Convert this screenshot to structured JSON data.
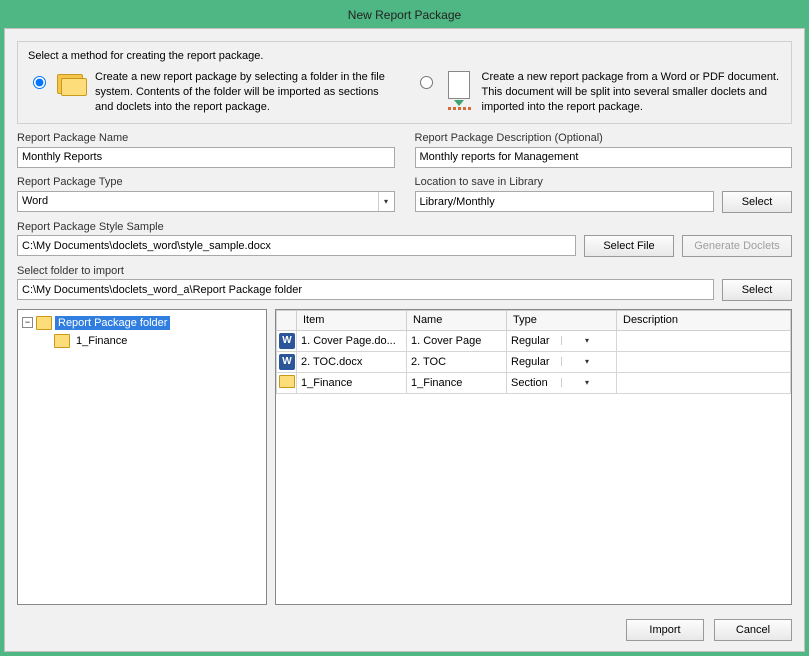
{
  "title": "New Report Package",
  "method": {
    "label": "Select a method for creating the report package.",
    "opt1": "Create a new report package by selecting a folder in the file system. Contents of the folder will be imported as sections and doclets into the report package.",
    "opt2": "Create a new report package from a Word or PDF document. This document will be split into several smaller doclets and imported into the report package."
  },
  "labels": {
    "name": "Report Package Name",
    "desc": "Report Package Description (Optional)",
    "type": "Report Package Type",
    "location": "Location to save in Library",
    "style": "Report Package Style Sample",
    "folder": "Select folder to import"
  },
  "values": {
    "name": "Monthly Reports",
    "desc": "Monthly reports for Management",
    "type": "Word",
    "location": "Library/Monthly",
    "style": "C:\\My Documents\\doclets_word\\style_sample.docx",
    "folder": "C:\\My Documents\\doclets_word_a\\Report Package folder"
  },
  "buttons": {
    "select": "Select",
    "selectFile": "Select File",
    "generate": "Generate Doclets",
    "import": "Import",
    "cancel": "Cancel"
  },
  "tree": {
    "root": "Report Package folder",
    "child1": "1_Finance"
  },
  "grid": {
    "headers": {
      "item": "Item",
      "name": "Name",
      "type": "Type",
      "desc": "Description"
    },
    "rows": [
      {
        "icon": "word",
        "item": "1. Cover Page.do...",
        "name": "1. Cover Page",
        "type": "Regular",
        "desc": ""
      },
      {
        "icon": "word",
        "item": "2. TOC.docx",
        "name": "2. TOC",
        "type": "Regular",
        "desc": ""
      },
      {
        "icon": "folder",
        "item": "1_Finance",
        "name": "1_Finance",
        "type": "Section",
        "desc": ""
      }
    ]
  }
}
